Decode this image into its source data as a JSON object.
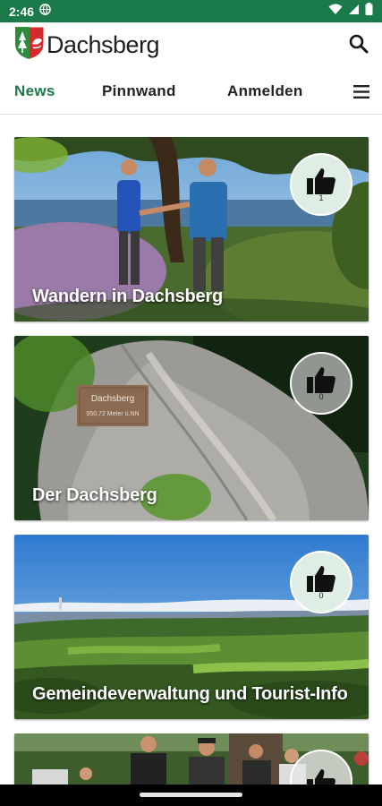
{
  "status_bar": {
    "time": "2:46"
  },
  "app_bar": {
    "brand": "Dachsberg"
  },
  "tabs": [
    {
      "label": "News",
      "active": true
    },
    {
      "label": "Pinnwand",
      "active": false
    },
    {
      "label": "Anmelden",
      "active": false
    }
  ],
  "cards": [
    {
      "title": "Wandern in Dachsberg",
      "likes": "1"
    },
    {
      "title": "Der Dachsberg",
      "likes": "0"
    },
    {
      "title": "Gemeindeverwaltung und Tourist-Info",
      "likes": "0"
    },
    {
      "title": "",
      "likes": ""
    }
  ],
  "sign_text": [
    "Dachsberg",
    "950,72 Meter ü.NN"
  ],
  "colors": {
    "primary": "#1b7a4a",
    "status_bar": "#1b7a4a"
  }
}
